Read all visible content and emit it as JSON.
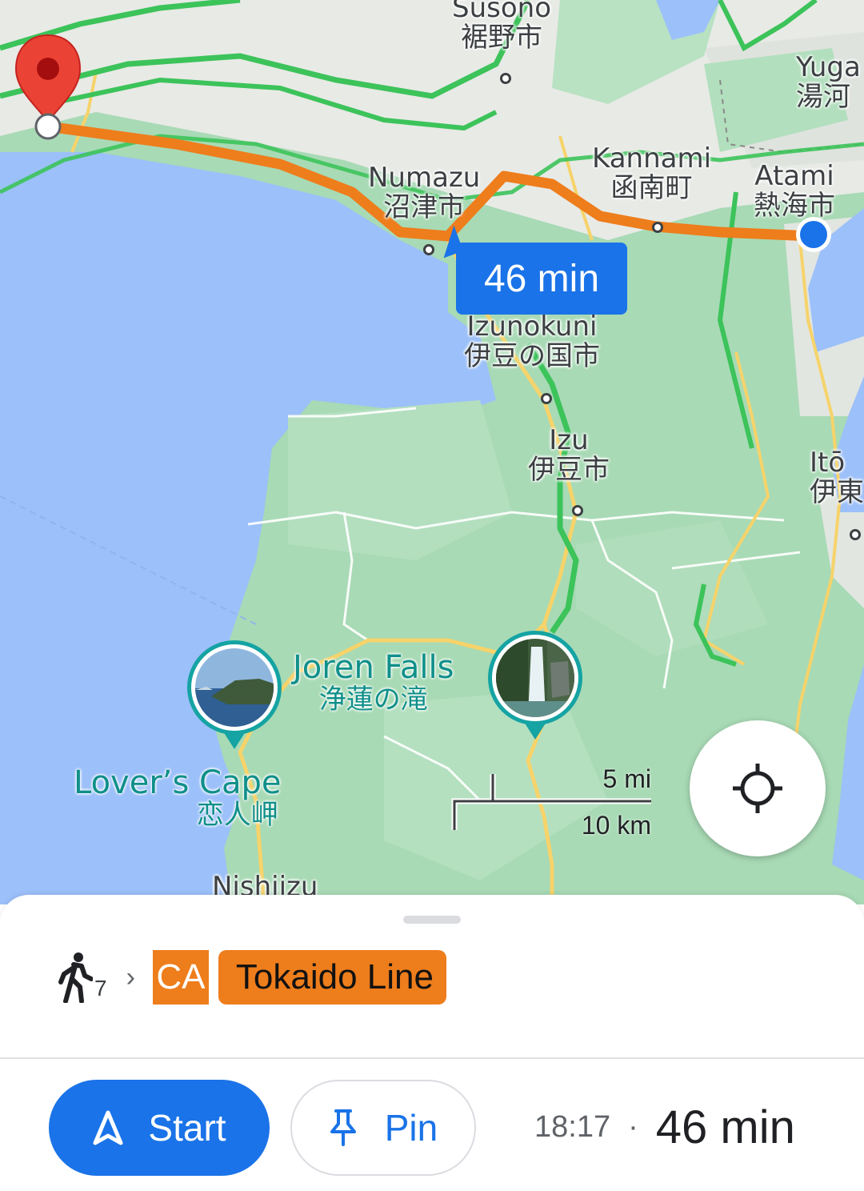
{
  "map": {
    "places": [
      {
        "en": "Susono",
        "jp": "裾野市"
      },
      {
        "en": "Yuga",
        "jp": "湯河"
      },
      {
        "en": "Kannami",
        "jp": "函南町"
      },
      {
        "en": "Atami",
        "jp": "熱海市"
      },
      {
        "en": "Numazu",
        "jp": "沼津市"
      },
      {
        "en": "Izunokuni",
        "jp": "伊豆の国市"
      },
      {
        "en": "Izu",
        "jp": "伊豆市"
      },
      {
        "en": "Itō",
        "jp": "伊東"
      },
      {
        "en": "Nishiizu",
        "jp": ""
      }
    ],
    "pois": [
      {
        "en": "Joren Falls",
        "jp": "浄蓮の滝"
      },
      {
        "en": "Lover’s Cape",
        "jp": "恋人岬"
      }
    ],
    "route_bubble": "46 min",
    "scale": {
      "mi": "5 mi",
      "km": "10 km"
    },
    "icons": {
      "destination": "red-map-pin-icon",
      "origin": "blue-location-dot-icon",
      "locate": "my-location-icon"
    },
    "colors": {
      "route": "#ee7d1c",
      "water": "#9cc0f9",
      "land": "#a8dab5",
      "bubble": "#1a73e8"
    }
  },
  "sheet": {
    "walk_minutes": "7",
    "line_code": "CA",
    "line_name": "Tokaido Line",
    "start_label": "Start",
    "pin_label": "Pin",
    "arrival_time": "18:17",
    "separator": "·",
    "duration": "46 min",
    "icons": {
      "walk": "walking-person-icon",
      "chevron": "chevron-right-icon",
      "start": "navigation-arrow-icon",
      "pin": "pushpin-icon"
    },
    "colors": {
      "line": "#ee7d1c",
      "primary": "#1a73e8"
    }
  }
}
